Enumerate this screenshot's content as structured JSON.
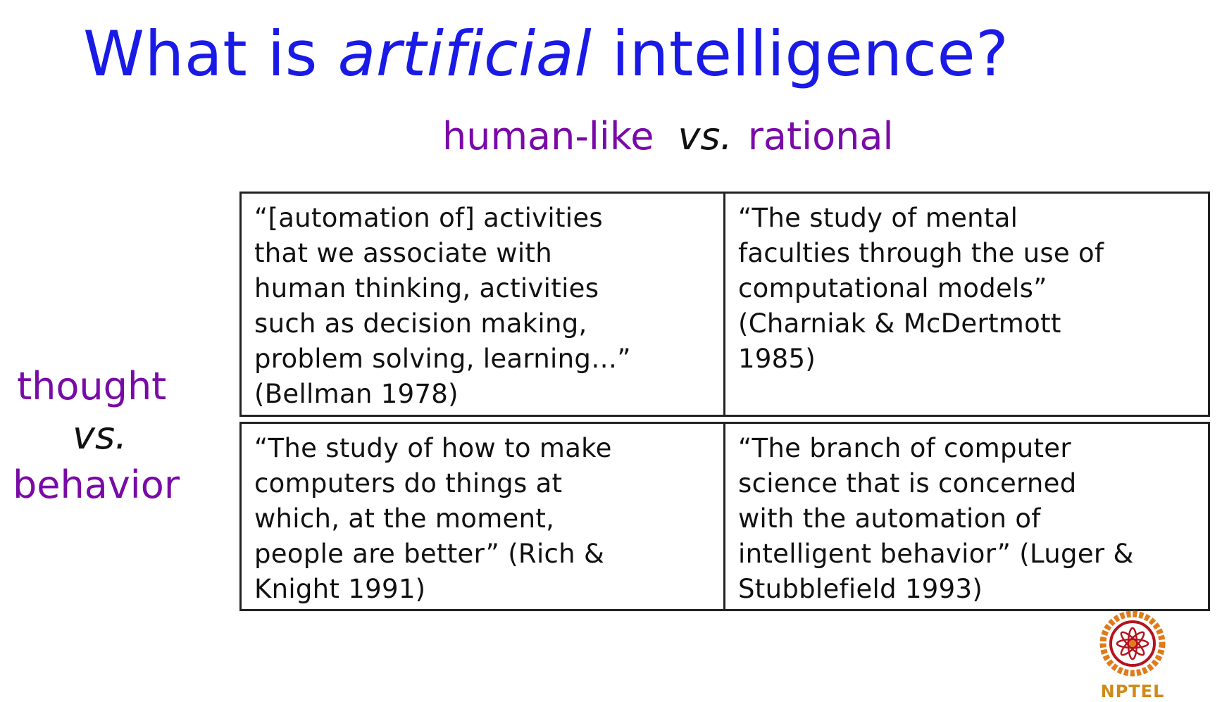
{
  "title": {
    "before": "What is ",
    "italic": "artificial",
    "after": " intelligence?"
  },
  "header": {
    "left": "human-like",
    "vs": "vs.",
    "right": "rational"
  },
  "side": {
    "top": "thought",
    "vs": "vs.",
    "bottom": "behavior"
  },
  "quadrants": {
    "top_left": [
      "“[automation of] activities",
      "that we associate with",
      "human thinking, activities",
      "such as decision making,",
      "problem solving, learning…”",
      "(Bellman 1978)"
    ],
    "top_right": [
      "“The study of mental",
      "faculties through the use of",
      "computational models”",
      "(Charniak & McDertmott",
      "1985)"
    ],
    "bottom_left": [
      "“The study of how to make",
      "computers do things at",
      "which, at the moment,",
      "people are better” (Rich &",
      "Knight 1991)"
    ],
    "bottom_right": [
      "“The branch of computer",
      "science that is concerned",
      "with the automation of",
      "intelligent behavior” (Luger &",
      "Stubblefield 1993)"
    ]
  },
  "logo": {
    "text": "NPTEL",
    "colors": {
      "ring": "#e07b1a",
      "inner": "#b4141e",
      "text": "#d08a1a"
    }
  },
  "colors": {
    "title": "#1a1ae6",
    "accent": "#7a0aa8",
    "text": "#111111",
    "border": "#222222"
  }
}
